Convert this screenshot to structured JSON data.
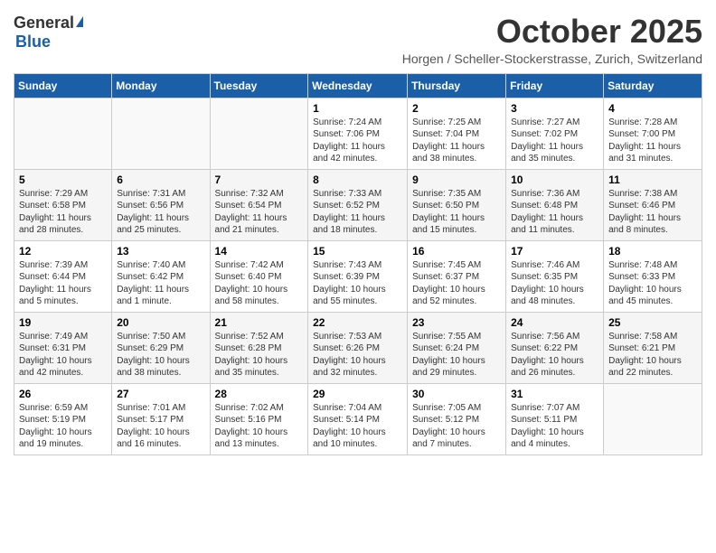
{
  "header": {
    "logo_general": "General",
    "logo_blue": "Blue",
    "month_title": "October 2025",
    "location": "Horgen / Scheller-Stockerstrasse, Zurich, Switzerland"
  },
  "weekdays": [
    "Sunday",
    "Monday",
    "Tuesday",
    "Wednesday",
    "Thursday",
    "Friday",
    "Saturday"
  ],
  "weeks": [
    [
      {
        "day": "",
        "info": ""
      },
      {
        "day": "",
        "info": ""
      },
      {
        "day": "",
        "info": ""
      },
      {
        "day": "1",
        "info": "Sunrise: 7:24 AM\nSunset: 7:06 PM\nDaylight: 11 hours and 42 minutes."
      },
      {
        "day": "2",
        "info": "Sunrise: 7:25 AM\nSunset: 7:04 PM\nDaylight: 11 hours and 38 minutes."
      },
      {
        "day": "3",
        "info": "Sunrise: 7:27 AM\nSunset: 7:02 PM\nDaylight: 11 hours and 35 minutes."
      },
      {
        "day": "4",
        "info": "Sunrise: 7:28 AM\nSunset: 7:00 PM\nDaylight: 11 hours and 31 minutes."
      }
    ],
    [
      {
        "day": "5",
        "info": "Sunrise: 7:29 AM\nSunset: 6:58 PM\nDaylight: 11 hours and 28 minutes."
      },
      {
        "day": "6",
        "info": "Sunrise: 7:31 AM\nSunset: 6:56 PM\nDaylight: 11 hours and 25 minutes."
      },
      {
        "day": "7",
        "info": "Sunrise: 7:32 AM\nSunset: 6:54 PM\nDaylight: 11 hours and 21 minutes."
      },
      {
        "day": "8",
        "info": "Sunrise: 7:33 AM\nSunset: 6:52 PM\nDaylight: 11 hours and 18 minutes."
      },
      {
        "day": "9",
        "info": "Sunrise: 7:35 AM\nSunset: 6:50 PM\nDaylight: 11 hours and 15 minutes."
      },
      {
        "day": "10",
        "info": "Sunrise: 7:36 AM\nSunset: 6:48 PM\nDaylight: 11 hours and 11 minutes."
      },
      {
        "day": "11",
        "info": "Sunrise: 7:38 AM\nSunset: 6:46 PM\nDaylight: 11 hours and 8 minutes."
      }
    ],
    [
      {
        "day": "12",
        "info": "Sunrise: 7:39 AM\nSunset: 6:44 PM\nDaylight: 11 hours and 5 minutes."
      },
      {
        "day": "13",
        "info": "Sunrise: 7:40 AM\nSunset: 6:42 PM\nDaylight: 11 hours and 1 minute."
      },
      {
        "day": "14",
        "info": "Sunrise: 7:42 AM\nSunset: 6:40 PM\nDaylight: 10 hours and 58 minutes."
      },
      {
        "day": "15",
        "info": "Sunrise: 7:43 AM\nSunset: 6:39 PM\nDaylight: 10 hours and 55 minutes."
      },
      {
        "day": "16",
        "info": "Sunrise: 7:45 AM\nSunset: 6:37 PM\nDaylight: 10 hours and 52 minutes."
      },
      {
        "day": "17",
        "info": "Sunrise: 7:46 AM\nSunset: 6:35 PM\nDaylight: 10 hours and 48 minutes."
      },
      {
        "day": "18",
        "info": "Sunrise: 7:48 AM\nSunset: 6:33 PM\nDaylight: 10 hours and 45 minutes."
      }
    ],
    [
      {
        "day": "19",
        "info": "Sunrise: 7:49 AM\nSunset: 6:31 PM\nDaylight: 10 hours and 42 minutes."
      },
      {
        "day": "20",
        "info": "Sunrise: 7:50 AM\nSunset: 6:29 PM\nDaylight: 10 hours and 38 minutes."
      },
      {
        "day": "21",
        "info": "Sunrise: 7:52 AM\nSunset: 6:28 PM\nDaylight: 10 hours and 35 minutes."
      },
      {
        "day": "22",
        "info": "Sunrise: 7:53 AM\nSunset: 6:26 PM\nDaylight: 10 hours and 32 minutes."
      },
      {
        "day": "23",
        "info": "Sunrise: 7:55 AM\nSunset: 6:24 PM\nDaylight: 10 hours and 29 minutes."
      },
      {
        "day": "24",
        "info": "Sunrise: 7:56 AM\nSunset: 6:22 PM\nDaylight: 10 hours and 26 minutes."
      },
      {
        "day": "25",
        "info": "Sunrise: 7:58 AM\nSunset: 6:21 PM\nDaylight: 10 hours and 22 minutes."
      }
    ],
    [
      {
        "day": "26",
        "info": "Sunrise: 6:59 AM\nSunset: 5:19 PM\nDaylight: 10 hours and 19 minutes."
      },
      {
        "day": "27",
        "info": "Sunrise: 7:01 AM\nSunset: 5:17 PM\nDaylight: 10 hours and 16 minutes."
      },
      {
        "day": "28",
        "info": "Sunrise: 7:02 AM\nSunset: 5:16 PM\nDaylight: 10 hours and 13 minutes."
      },
      {
        "day": "29",
        "info": "Sunrise: 7:04 AM\nSunset: 5:14 PM\nDaylight: 10 hours and 10 minutes."
      },
      {
        "day": "30",
        "info": "Sunrise: 7:05 AM\nSunset: 5:12 PM\nDaylight: 10 hours and 7 minutes."
      },
      {
        "day": "31",
        "info": "Sunrise: 7:07 AM\nSunset: 5:11 PM\nDaylight: 10 hours and 4 minutes."
      },
      {
        "day": "",
        "info": ""
      }
    ]
  ]
}
